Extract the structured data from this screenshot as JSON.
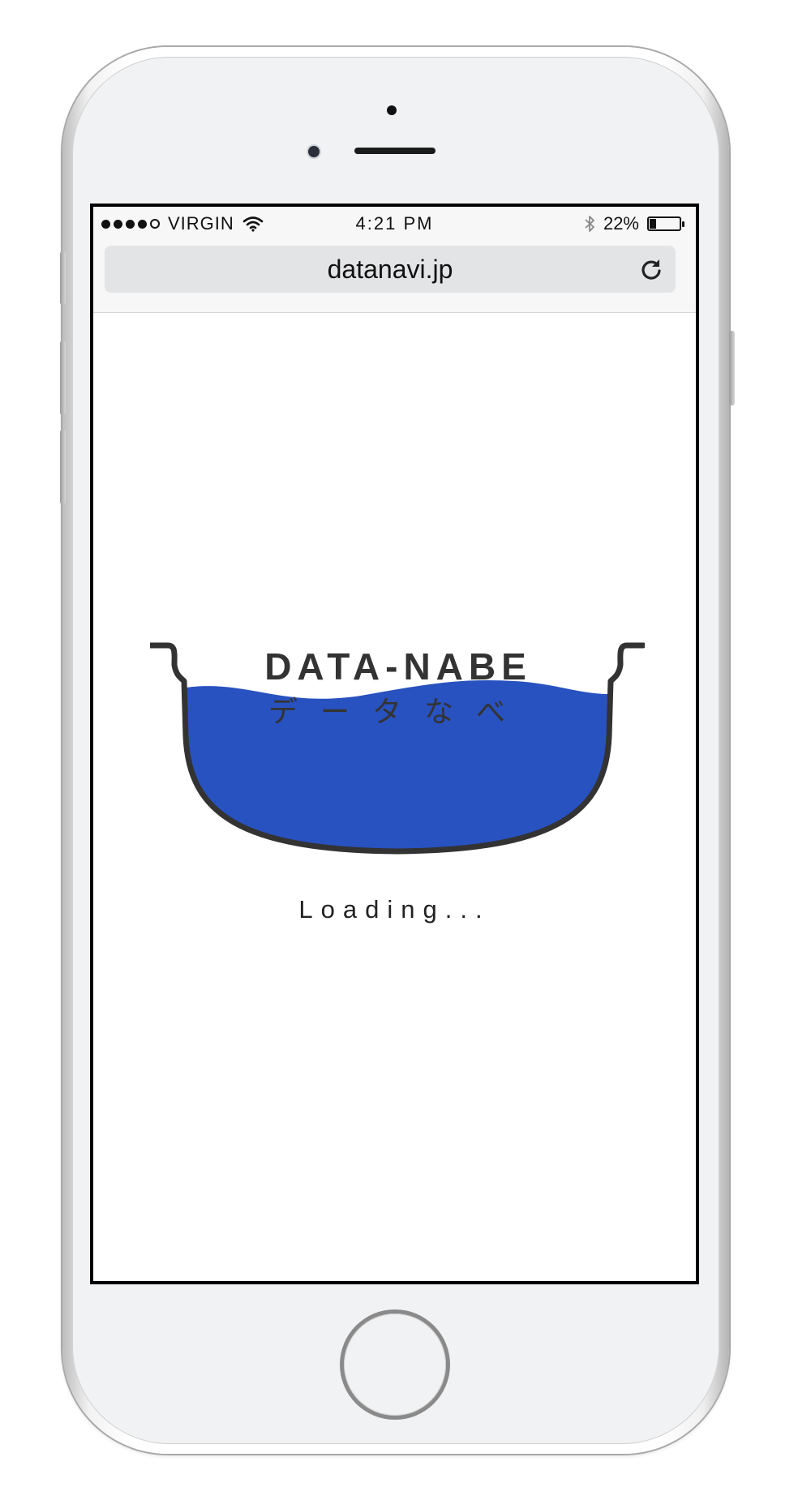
{
  "status_bar": {
    "carrier": "VIRGIN",
    "signal_bars": 4,
    "signal_max": 5,
    "time": "4:21 PM",
    "battery_percent_label": "22%",
    "battery_level": 0.22,
    "icons": [
      "signal-dots-icon",
      "wifi-icon",
      "bluetooth-icon",
      "battery-icon"
    ]
  },
  "browser": {
    "url": "datanavi.jp",
    "reload_icon": "reload-icon"
  },
  "logo": {
    "title": "DATA-NABE",
    "subtitle": "データなべ",
    "pot_color": "#2852bf",
    "outline_color": "#333333"
  },
  "loading_text": "Loading..."
}
